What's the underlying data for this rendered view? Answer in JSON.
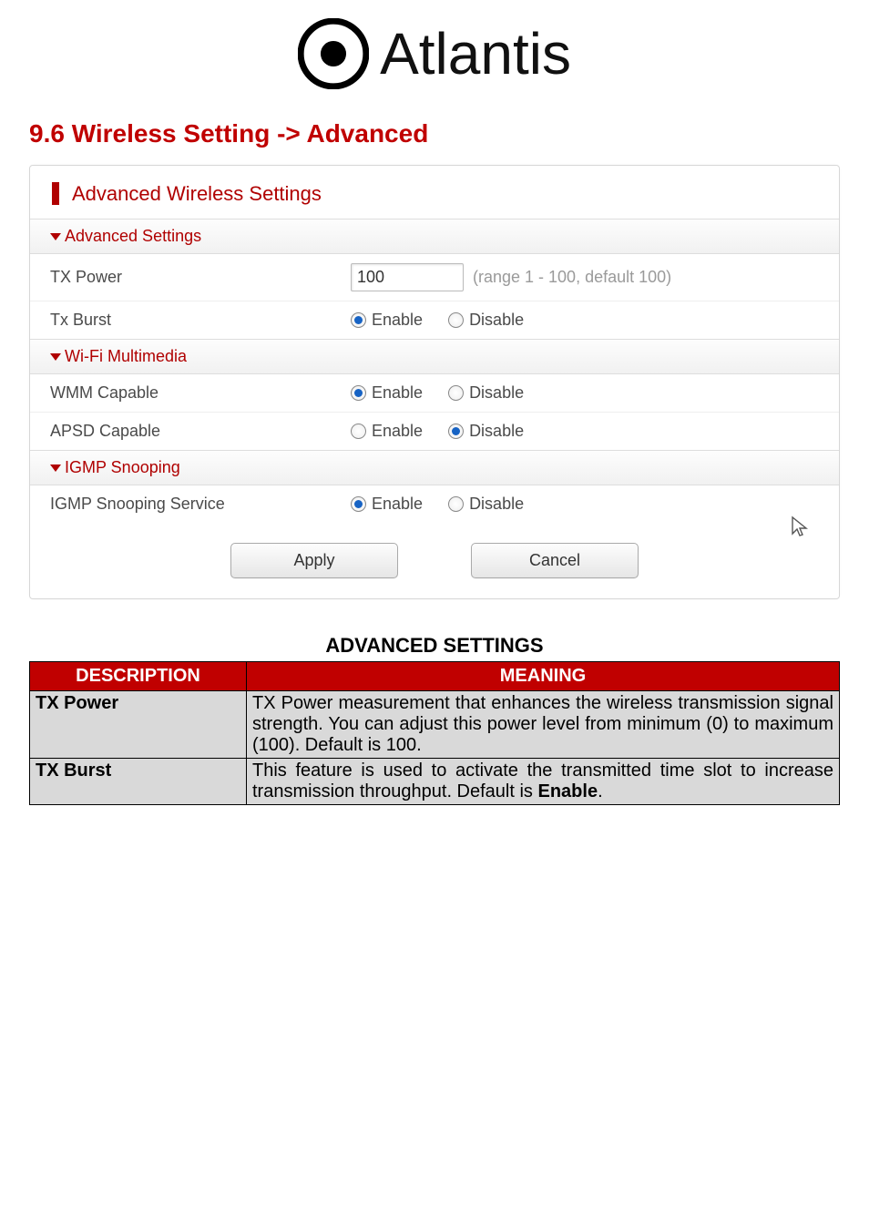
{
  "logo": {
    "brand": "Atlantis"
  },
  "heading": "9.6 Wireless Setting -> Advanced",
  "panel": {
    "title": "Advanced Wireless Settings",
    "groups": {
      "advanced": {
        "header": "Advanced Settings",
        "tx_power": {
          "label": "TX Power",
          "value": "100",
          "hint": "(range 1 - 100, default 100)"
        },
        "tx_burst": {
          "label": "Tx Burst",
          "enable": "Enable",
          "disable": "Disable",
          "selected": "enable"
        }
      },
      "wifi_mm": {
        "header": "Wi-Fi Multimedia",
        "wmm": {
          "label": "WMM Capable",
          "enable": "Enable",
          "disable": "Disable",
          "selected": "enable"
        },
        "apsd": {
          "label": "APSD Capable",
          "enable": "Enable",
          "disable": "Disable",
          "selected": "disable"
        }
      },
      "igmp": {
        "header": "IGMP Snooping",
        "svc": {
          "label": "IGMP Snooping Service",
          "enable": "Enable",
          "disable": "Disable",
          "selected": "enable"
        }
      }
    },
    "buttons": {
      "apply": "Apply",
      "cancel": "Cancel"
    }
  },
  "table": {
    "title": "ADVANCED SETTINGS",
    "headers": {
      "description": "DESCRIPTION",
      "meaning": "MEANING"
    },
    "rows": {
      "tx_power": {
        "term": "TX Power",
        "meaning": "TX Power measurement that enhances the wireless transmission signal strength. You can adjust this power level from minimum (0) to maximum (100). Default is 100."
      },
      "tx_burst": {
        "term": "TX Burst",
        "meaning_pre": "This feature is used to activate the transmitted time slot to increase transmission throughput. Default is ",
        "meaning_bold": "Enable",
        "meaning_post": "."
      }
    }
  }
}
